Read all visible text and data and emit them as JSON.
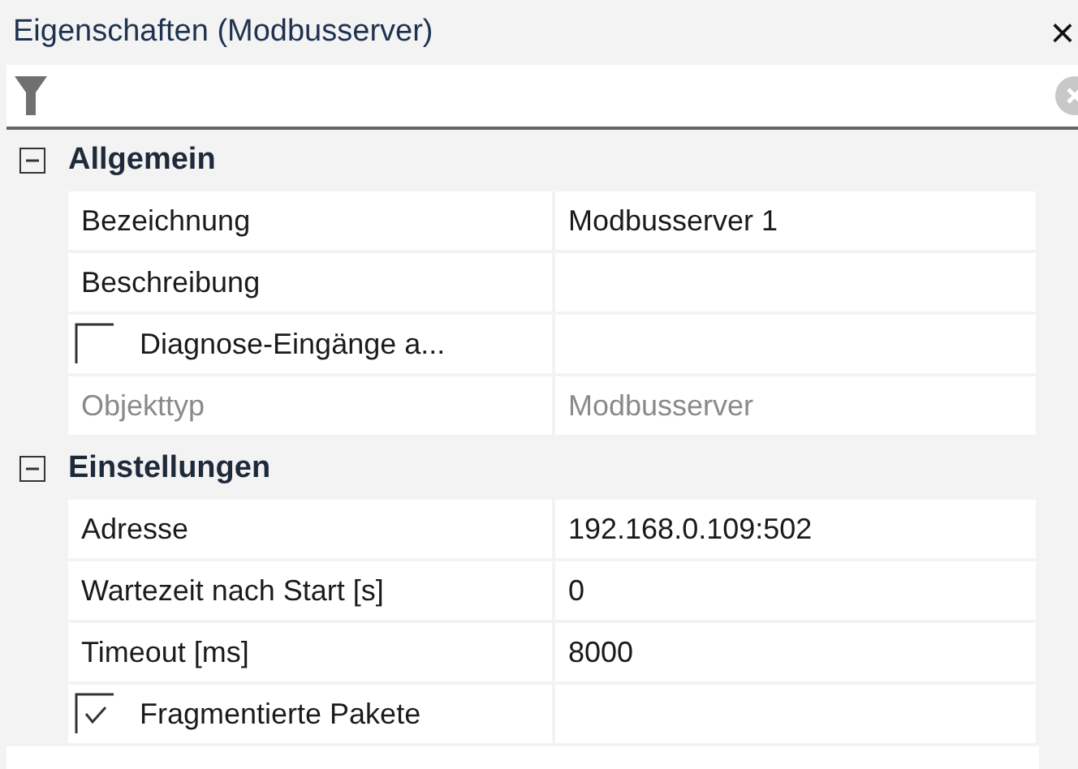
{
  "panel": {
    "title": "Eigenschaften (Modbusserver)",
    "close_glyph": "×"
  },
  "categories": [
    {
      "name": "Allgemein",
      "expanded": true,
      "properties": [
        {
          "kind": "text",
          "label": "Bezeichnung",
          "value": "Modbusserver 1",
          "disabled": false
        },
        {
          "kind": "text",
          "label": "Beschreibung",
          "disabled": false
        },
        {
          "kind": "checkbox",
          "label": "Diagnose-Eingänge a...",
          "checked": false
        },
        {
          "kind": "text",
          "label": "Objekttyp",
          "value": "Modbusserver",
          "disabled": true
        }
      ]
    },
    {
      "name": "Einstellungen",
      "expanded": true,
      "properties": [
        {
          "kind": "text",
          "label": "Adresse",
          "value": "192.168.0.109:502",
          "disabled": false
        },
        {
          "kind": "text",
          "label": "Wartezeit nach Start [s]",
          "value": "0",
          "disabled": false
        },
        {
          "kind": "text",
          "label": "Timeout [ms]",
          "value": "8000",
          "disabled": false
        },
        {
          "kind": "checkbox",
          "label": "Fragmentierte Pakete",
          "checked": true
        }
      ]
    }
  ]
}
